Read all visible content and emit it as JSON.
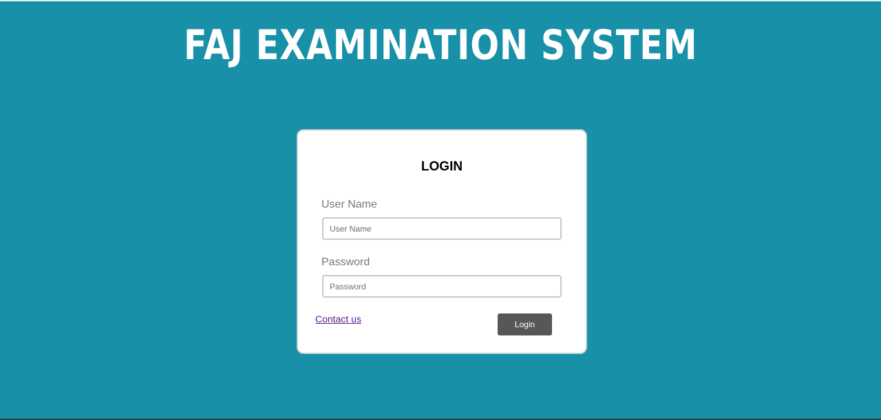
{
  "header": {
    "title": "FAJ EXAMINATION SYSTEM"
  },
  "login_form": {
    "heading": "LOGIN",
    "username": {
      "label": "User Name",
      "placeholder": "User Name",
      "value": ""
    },
    "password": {
      "label": "Password",
      "placeholder": "Password",
      "value": ""
    },
    "contact_link": "Contact us",
    "submit_label": "Login"
  },
  "colors": {
    "background": "#1790a8",
    "card": "#ffffff",
    "button": "#575757",
    "link": "#551a8b"
  }
}
